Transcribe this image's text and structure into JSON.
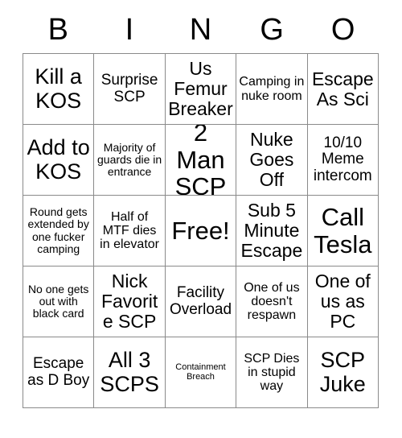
{
  "card": {
    "title": "BINGO",
    "header_letters": [
      "B",
      "I",
      "N",
      "G",
      "O"
    ],
    "colors": {
      "background": "#ffffff",
      "text": "#000000",
      "grid_line": "#8a8a8a"
    },
    "free_space_index": 12,
    "cells": [
      {
        "text": "Kill a KOS",
        "size": "xl"
      },
      {
        "text": "Surprise SCP",
        "size": "md"
      },
      {
        "text": "Us Femur Breaker",
        "size": "lg"
      },
      {
        "text": "Camping in nuke room",
        "size": "sm"
      },
      {
        "text": "Escape As Sci",
        "size": "lg"
      },
      {
        "text": "Add to KOS",
        "size": "xl"
      },
      {
        "text": "Majority of guards die in entrance",
        "size": "xs"
      },
      {
        "text": "2 Man SCP",
        "size": "xxl"
      },
      {
        "text": "Nuke Goes Off",
        "size": "lg"
      },
      {
        "text": "10/10 Meme intercom",
        "size": "md"
      },
      {
        "text": "Round gets extended by one fucker camping",
        "size": "xs"
      },
      {
        "text": "Half of MTF dies in elevator",
        "size": "sm"
      },
      {
        "text": "Free!",
        "size": "xxl"
      },
      {
        "text": "Sub 5 Minute Escape",
        "size": "lg"
      },
      {
        "text": "Call Tesla",
        "size": "xxl"
      },
      {
        "text": "No one gets out with black card",
        "size": "xs"
      },
      {
        "text": "Nick Favorite SCP",
        "size": "lg"
      },
      {
        "text": "Facility Overload",
        "size": "md"
      },
      {
        "text": "One of us doesn't respawn",
        "size": "sm"
      },
      {
        "text": "One of us as PC",
        "size": "lg"
      },
      {
        "text": "Escape as D Boy",
        "size": "md"
      },
      {
        "text": "All 3 SCPS",
        "size": "xl"
      },
      {
        "text": "Containment Breach",
        "size": "xxs"
      },
      {
        "text": "SCP Dies in stupid way",
        "size": "sm"
      },
      {
        "text": "SCP Juke",
        "size": "xl"
      }
    ]
  }
}
